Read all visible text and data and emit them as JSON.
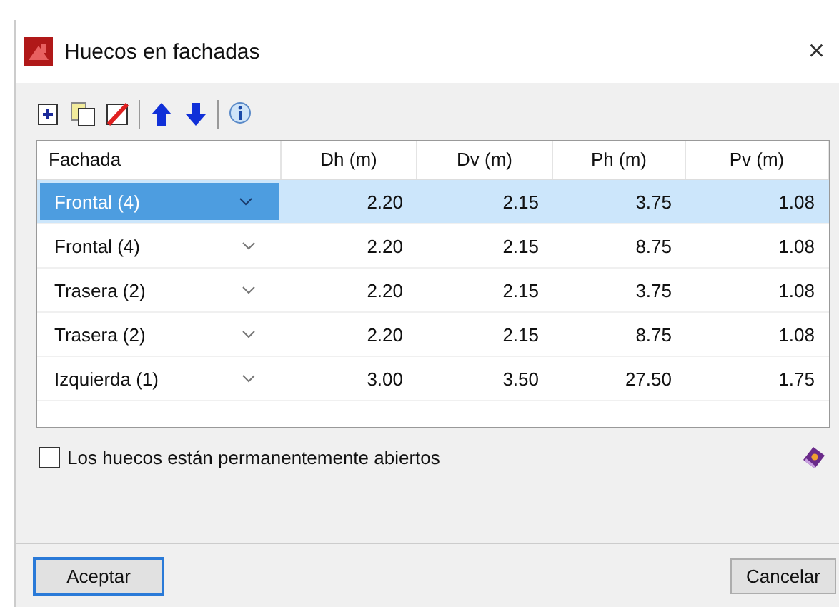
{
  "window": {
    "title": "Huecos en fachadas",
    "close": "×"
  },
  "table": {
    "columns": [
      "Fachada",
      "Dh (m)",
      "Dv (m)",
      "Ph (m)",
      "Pv (m)"
    ],
    "rows": [
      {
        "fachada": "Frontal (4)",
        "cells": [
          "2.20",
          "2.15",
          "3.75",
          "1.08"
        ],
        "selected": true
      },
      {
        "fachada": "Frontal (4)",
        "cells": [
          "2.20",
          "2.15",
          "8.75",
          "1.08"
        ],
        "selected": false
      },
      {
        "fachada": "Trasera (2)",
        "cells": [
          "2.20",
          "2.15",
          "3.75",
          "1.08"
        ],
        "selected": false
      },
      {
        "fachada": "Trasera (2)",
        "cells": [
          "2.20",
          "2.15",
          "8.75",
          "1.08"
        ],
        "selected": false
      },
      {
        "fachada": "Izquierda (1)",
        "cells": [
          "3.00",
          "3.50",
          "27.50",
          "1.75"
        ],
        "selected": false
      }
    ]
  },
  "option": {
    "label": "Los huecos están permanentemente abiertos",
    "checked": false
  },
  "buttons": [
    {
      "label": "Aceptar",
      "default": true
    },
    {
      "label": "Cancelar",
      "default": false
    }
  ]
}
